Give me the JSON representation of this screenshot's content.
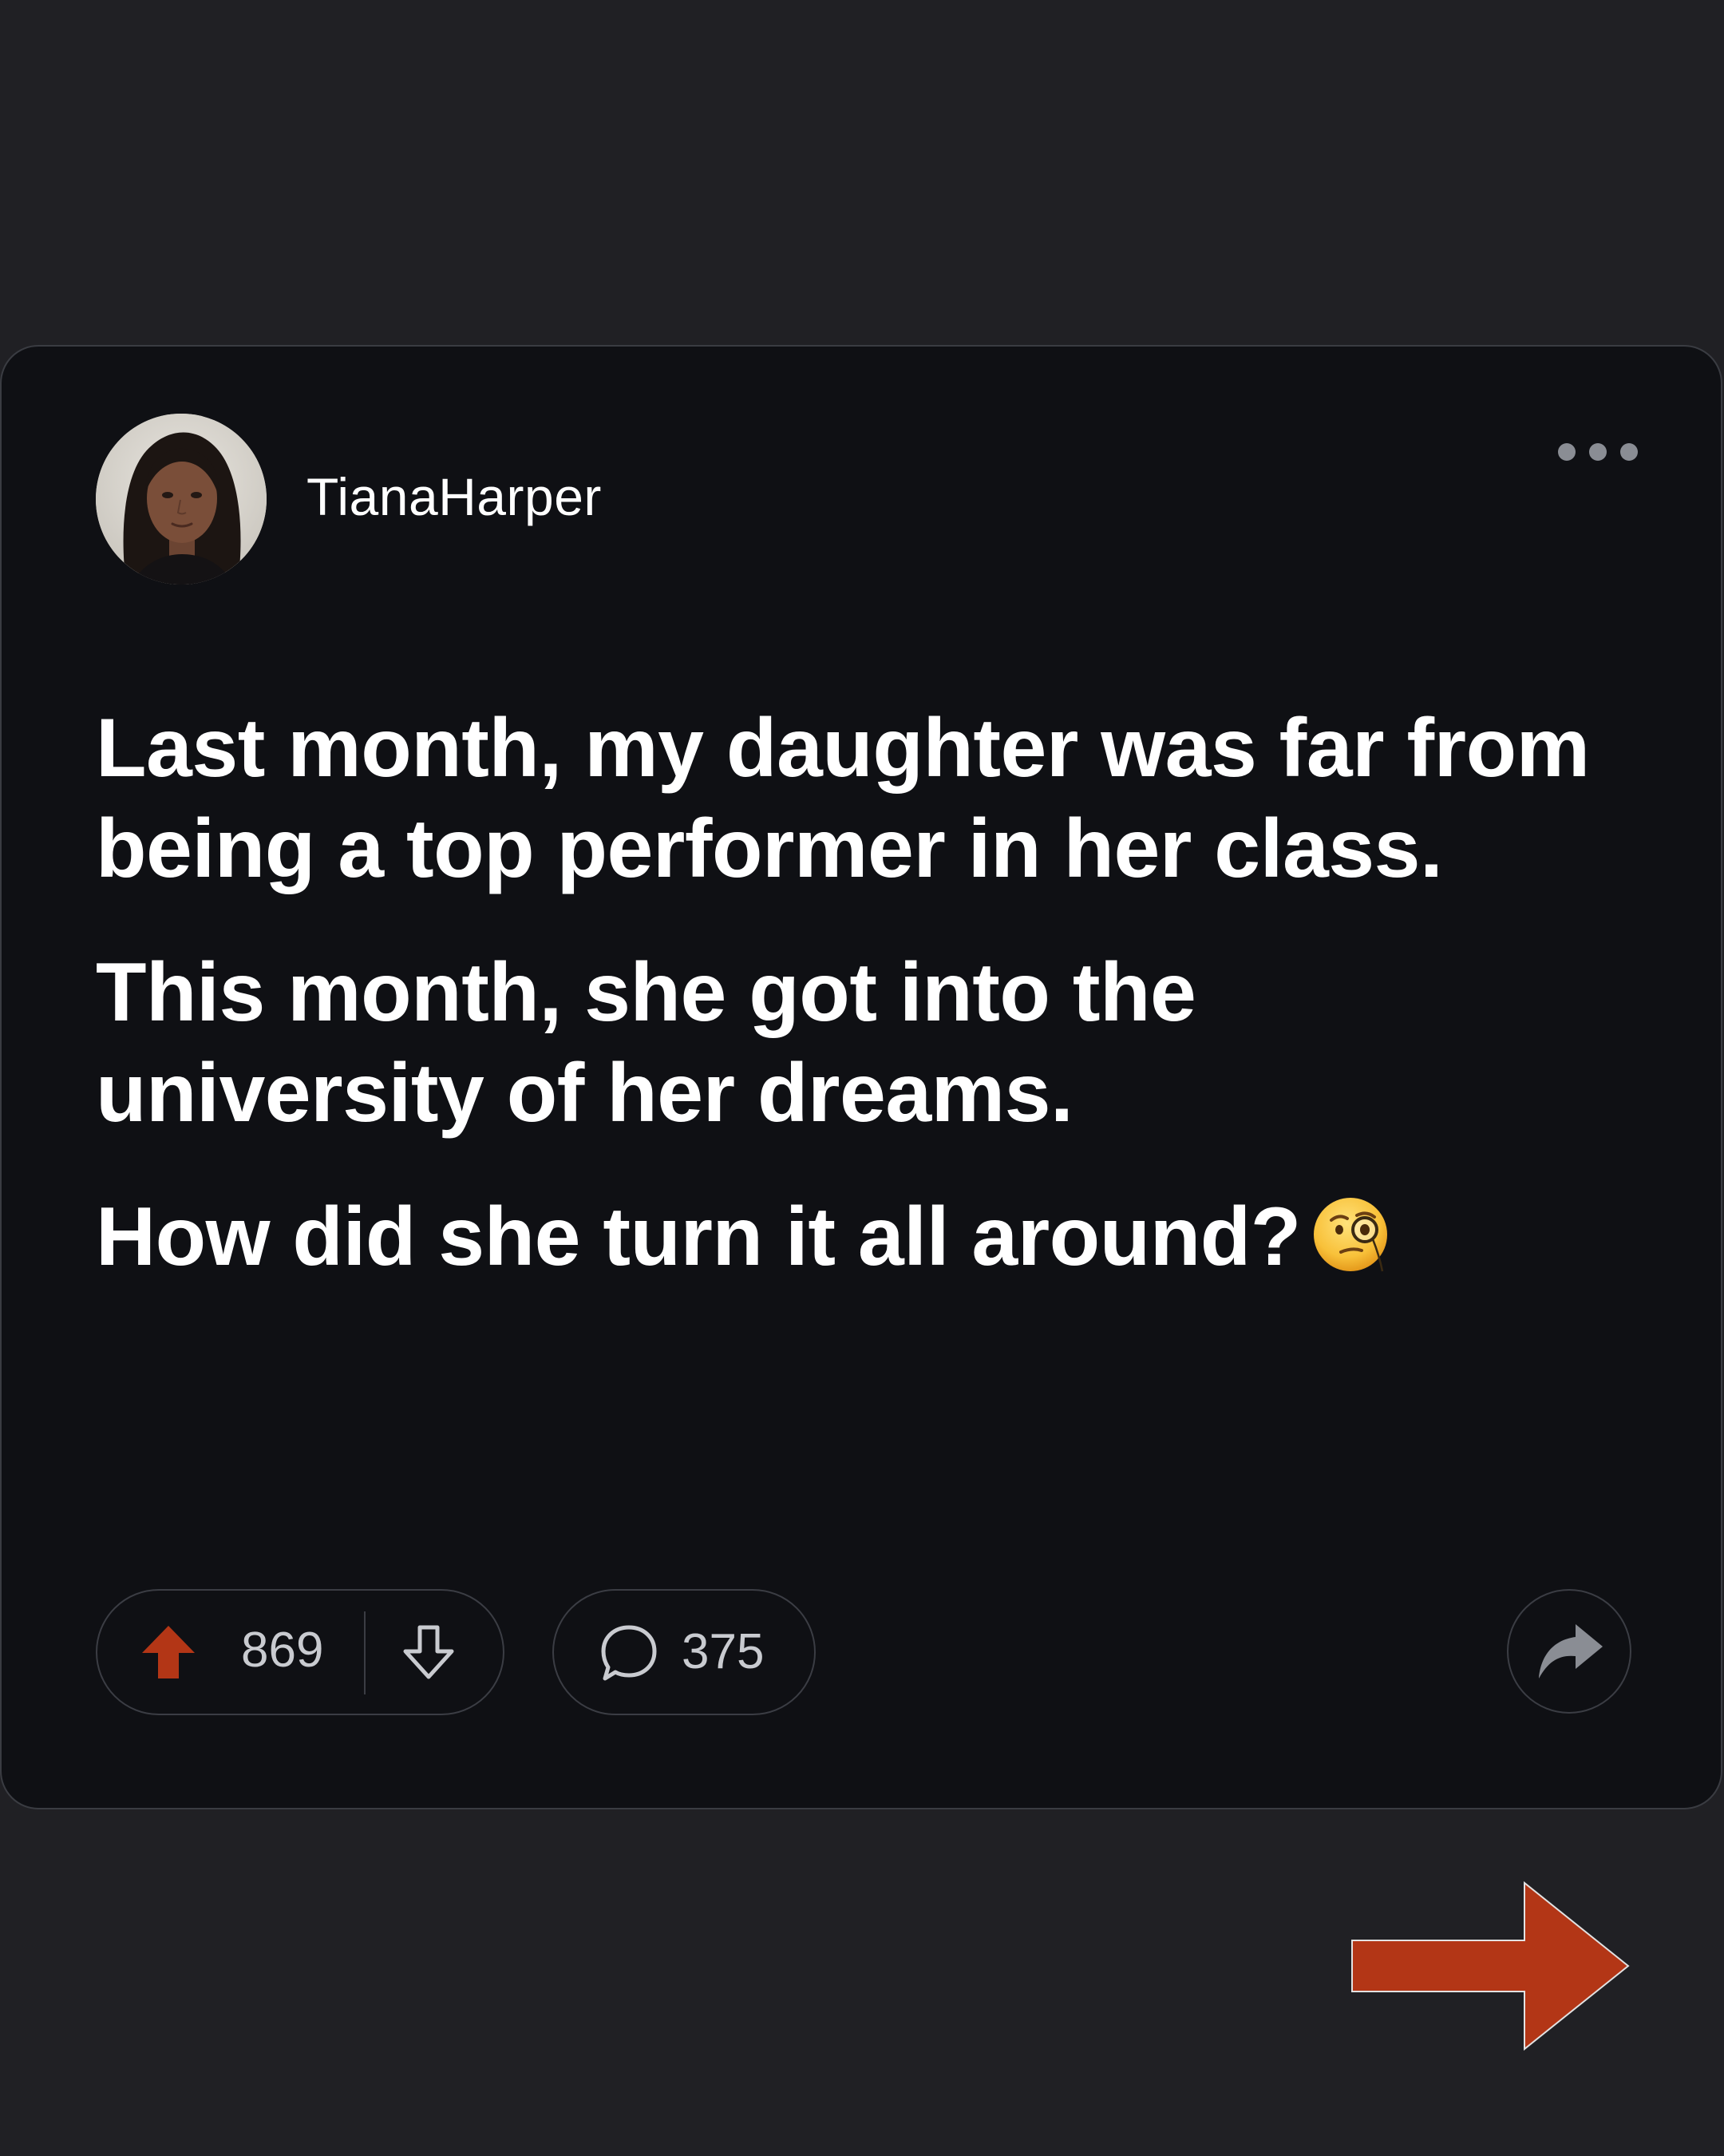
{
  "post": {
    "username": "TianaHarper",
    "paragraphs": [
      "Last month, my daughter was far from being a top performer in her class.",
      "This month, she got into the university of her dreams.",
      "How did she turn it all around?"
    ],
    "emoji": "face-with-monocle"
  },
  "actions": {
    "upvotes": "869",
    "comments": "375",
    "upvote_icon": "arrow-up-icon",
    "downvote_icon": "arrow-down-icon",
    "comment_icon": "speech-bubble-icon",
    "share_icon": "share-arrow-icon",
    "more_icon": "more-dots-icon"
  },
  "navigation": {
    "next_icon": "arrow-right-icon"
  },
  "colors": {
    "page_background": "#202024",
    "card_background": "#0f1014",
    "accent": "#b33616",
    "text_primary": "#ffffff",
    "text_secondary": "#c9cbd0",
    "border": "#3b3d44"
  }
}
